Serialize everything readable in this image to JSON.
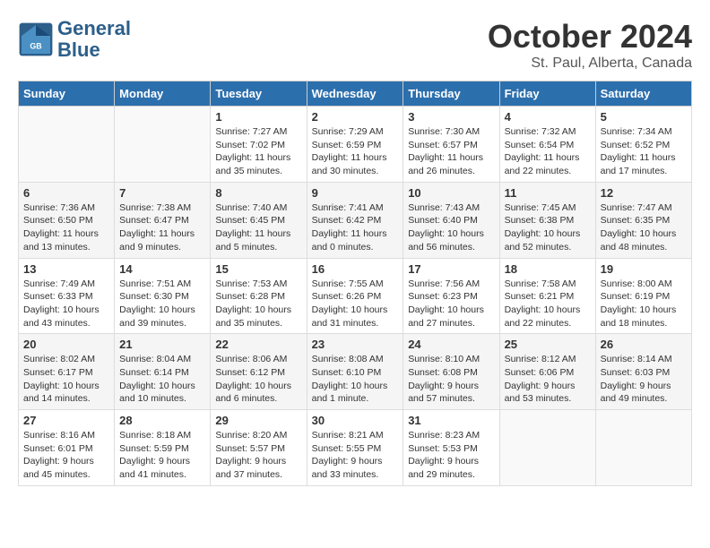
{
  "header": {
    "logo_line1": "General",
    "logo_line2": "Blue",
    "month": "October 2024",
    "location": "St. Paul, Alberta, Canada"
  },
  "weekdays": [
    "Sunday",
    "Monday",
    "Tuesday",
    "Wednesday",
    "Thursday",
    "Friday",
    "Saturday"
  ],
  "weeks": [
    [
      {
        "day": "",
        "info": ""
      },
      {
        "day": "",
        "info": ""
      },
      {
        "day": "1",
        "info": "Sunrise: 7:27 AM\nSunset: 7:02 PM\nDaylight: 11 hours and 35 minutes."
      },
      {
        "day": "2",
        "info": "Sunrise: 7:29 AM\nSunset: 6:59 PM\nDaylight: 11 hours and 30 minutes."
      },
      {
        "day": "3",
        "info": "Sunrise: 7:30 AM\nSunset: 6:57 PM\nDaylight: 11 hours and 26 minutes."
      },
      {
        "day": "4",
        "info": "Sunrise: 7:32 AM\nSunset: 6:54 PM\nDaylight: 11 hours and 22 minutes."
      },
      {
        "day": "5",
        "info": "Sunrise: 7:34 AM\nSunset: 6:52 PM\nDaylight: 11 hours and 17 minutes."
      }
    ],
    [
      {
        "day": "6",
        "info": "Sunrise: 7:36 AM\nSunset: 6:50 PM\nDaylight: 11 hours and 13 minutes."
      },
      {
        "day": "7",
        "info": "Sunrise: 7:38 AM\nSunset: 6:47 PM\nDaylight: 11 hours and 9 minutes."
      },
      {
        "day": "8",
        "info": "Sunrise: 7:40 AM\nSunset: 6:45 PM\nDaylight: 11 hours and 5 minutes."
      },
      {
        "day": "9",
        "info": "Sunrise: 7:41 AM\nSunset: 6:42 PM\nDaylight: 11 hours and 0 minutes."
      },
      {
        "day": "10",
        "info": "Sunrise: 7:43 AM\nSunset: 6:40 PM\nDaylight: 10 hours and 56 minutes."
      },
      {
        "day": "11",
        "info": "Sunrise: 7:45 AM\nSunset: 6:38 PM\nDaylight: 10 hours and 52 minutes."
      },
      {
        "day": "12",
        "info": "Sunrise: 7:47 AM\nSunset: 6:35 PM\nDaylight: 10 hours and 48 minutes."
      }
    ],
    [
      {
        "day": "13",
        "info": "Sunrise: 7:49 AM\nSunset: 6:33 PM\nDaylight: 10 hours and 43 minutes."
      },
      {
        "day": "14",
        "info": "Sunrise: 7:51 AM\nSunset: 6:30 PM\nDaylight: 10 hours and 39 minutes."
      },
      {
        "day": "15",
        "info": "Sunrise: 7:53 AM\nSunset: 6:28 PM\nDaylight: 10 hours and 35 minutes."
      },
      {
        "day": "16",
        "info": "Sunrise: 7:55 AM\nSunset: 6:26 PM\nDaylight: 10 hours and 31 minutes."
      },
      {
        "day": "17",
        "info": "Sunrise: 7:56 AM\nSunset: 6:23 PM\nDaylight: 10 hours and 27 minutes."
      },
      {
        "day": "18",
        "info": "Sunrise: 7:58 AM\nSunset: 6:21 PM\nDaylight: 10 hours and 22 minutes."
      },
      {
        "day": "19",
        "info": "Sunrise: 8:00 AM\nSunset: 6:19 PM\nDaylight: 10 hours and 18 minutes."
      }
    ],
    [
      {
        "day": "20",
        "info": "Sunrise: 8:02 AM\nSunset: 6:17 PM\nDaylight: 10 hours and 14 minutes."
      },
      {
        "day": "21",
        "info": "Sunrise: 8:04 AM\nSunset: 6:14 PM\nDaylight: 10 hours and 10 minutes."
      },
      {
        "day": "22",
        "info": "Sunrise: 8:06 AM\nSunset: 6:12 PM\nDaylight: 10 hours and 6 minutes."
      },
      {
        "day": "23",
        "info": "Sunrise: 8:08 AM\nSunset: 6:10 PM\nDaylight: 10 hours and 1 minute."
      },
      {
        "day": "24",
        "info": "Sunrise: 8:10 AM\nSunset: 6:08 PM\nDaylight: 9 hours and 57 minutes."
      },
      {
        "day": "25",
        "info": "Sunrise: 8:12 AM\nSunset: 6:06 PM\nDaylight: 9 hours and 53 minutes."
      },
      {
        "day": "26",
        "info": "Sunrise: 8:14 AM\nSunset: 6:03 PM\nDaylight: 9 hours and 49 minutes."
      }
    ],
    [
      {
        "day": "27",
        "info": "Sunrise: 8:16 AM\nSunset: 6:01 PM\nDaylight: 9 hours and 45 minutes."
      },
      {
        "day": "28",
        "info": "Sunrise: 8:18 AM\nSunset: 5:59 PM\nDaylight: 9 hours and 41 minutes."
      },
      {
        "day": "29",
        "info": "Sunrise: 8:20 AM\nSunset: 5:57 PM\nDaylight: 9 hours and 37 minutes."
      },
      {
        "day": "30",
        "info": "Sunrise: 8:21 AM\nSunset: 5:55 PM\nDaylight: 9 hours and 33 minutes."
      },
      {
        "day": "31",
        "info": "Sunrise: 8:23 AM\nSunset: 5:53 PM\nDaylight: 9 hours and 29 minutes."
      },
      {
        "day": "",
        "info": ""
      },
      {
        "day": "",
        "info": ""
      }
    ]
  ]
}
